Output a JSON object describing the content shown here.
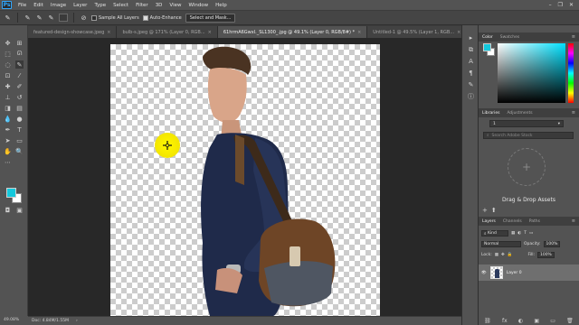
{
  "app": {
    "logo": "Ps"
  },
  "menu": [
    "File",
    "Edit",
    "Image",
    "Layer",
    "Type",
    "Select",
    "Filter",
    "3D",
    "View",
    "Window",
    "Help"
  ],
  "window_controls": [
    "–",
    "❐",
    "✕"
  ],
  "options": {
    "sample_all_layers": "Sample All Layers",
    "auto_enhance": "Auto-Enhance",
    "select_and_mask": "Select and Mask..."
  },
  "tabs": [
    {
      "title": "featured-design-showcase.jpeg",
      "close": "×"
    },
    {
      "title": "bulb-s.jpeg @ 171% (Layer 0, RGB...",
      "close": "×"
    },
    {
      "title": "61hrmA6Gwxl._SL1300_.jpg @ 49.1% (Layer 0, RGB/8#) *",
      "close": "×"
    },
    {
      "title": "Untitled-1 @ 49.5% (Layer 1, RGB...",
      "close": "×"
    }
  ],
  "status": {
    "zoom": "49.08%",
    "doc": "Doc: 4.84M/1.55M",
    "arrow": "›"
  },
  "color_panel": {
    "tab_color": "Color",
    "tab_swatches": "Swatches",
    "menu": "≡"
  },
  "libraries_panel": {
    "tab_libraries": "Libraries",
    "tab_adjustments": "Adjustments",
    "menu": "≡",
    "selector_value": "1",
    "search_placeholder": "Search Adobe Stock",
    "drag_text": "Drag & Drop Assets",
    "plus": "+"
  },
  "layers_panel": {
    "tab_layers": "Layers",
    "tab_channels": "Channels",
    "tab_paths": "Paths",
    "menu": "≡",
    "kind_label": "Kind",
    "blend_mode": "Normal",
    "opacity_label": "Opacity:",
    "opacity_value": "100%",
    "lock_label": "Lock:",
    "fill_label": "Fill:",
    "fill_value": "100%",
    "layer_name": "Layer 0",
    "footer_icons": [
      "⛓",
      "fx",
      "◐",
      "▣",
      "▭",
      "🗑"
    ]
  },
  "colors": {
    "foreground": "#14c8dc",
    "background": "#ffffff",
    "accent": "#31a8ff",
    "brush": "#f5e800"
  }
}
